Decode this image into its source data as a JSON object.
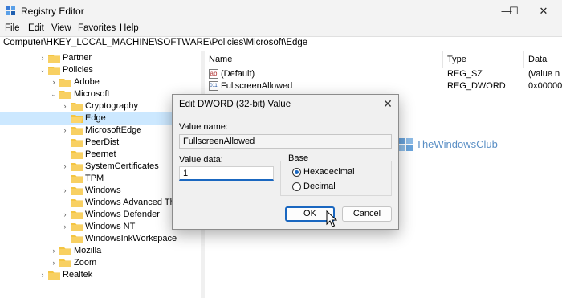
{
  "window": {
    "title": "Registry Editor",
    "controls": {
      "minimize": "—",
      "maximize": "☐",
      "close": "✕"
    }
  },
  "menu": [
    "File",
    "Edit",
    "View",
    "Favorites",
    "Help"
  ],
  "address": "Computer\\HKEY_LOCAL_MACHINE\\SOFTWARE\\Policies\\Microsoft\\Edge",
  "tree": [
    {
      "label": "Partner",
      "expander": "›"
    },
    {
      "label": "Policies",
      "expander": "⌄"
    },
    {
      "label": "Adobe",
      "expander": "›"
    },
    {
      "label": "Microsoft",
      "expander": "⌄"
    },
    {
      "label": "Cryptography",
      "expander": "›"
    },
    {
      "label": "Edge",
      "expander": "",
      "selected": true
    },
    {
      "label": "MicrosoftEdge",
      "expander": "›"
    },
    {
      "label": "PeerDist",
      "expander": ""
    },
    {
      "label": "Peernet",
      "expander": ""
    },
    {
      "label": "SystemCertificates",
      "expander": "›"
    },
    {
      "label": "TPM",
      "expander": ""
    },
    {
      "label": "Windows",
      "expander": "›"
    },
    {
      "label": "Windows Advanced Thre",
      "expander": ""
    },
    {
      "label": "Windows Defender",
      "expander": "›"
    },
    {
      "label": "Windows NT",
      "expander": "›"
    },
    {
      "label": "WindowsInkWorkspace",
      "expander": ""
    },
    {
      "label": "Mozilla",
      "expander": "›"
    },
    {
      "label": "Zoom",
      "expander": "›"
    },
    {
      "label": "Realtek",
      "expander": "›"
    }
  ],
  "list": {
    "columns": {
      "name": "Name",
      "type": "Type",
      "data": "Data"
    },
    "rows": [
      {
        "name": "(Default)",
        "type": "REG_SZ",
        "data": "(value n",
        "icon": "ab"
      },
      {
        "name": "FullscreenAllowed",
        "type": "REG_DWORD",
        "data": "0x00000",
        "icon": "011"
      }
    ]
  },
  "watermark": "TheWindowsClub",
  "dialog": {
    "title": "Edit DWORD (32-bit) Value",
    "close": "✕",
    "value_name_label": "Value name:",
    "value_name": "FullscreenAllowed",
    "value_data_label": "Value data:",
    "value_data": "1",
    "base_label": "Base",
    "hex_label": "Hexadecimal",
    "dec_label": "Decimal",
    "base_selected": "Hexadecimal",
    "ok": "OK",
    "cancel": "Cancel"
  },
  "colors": {
    "selection": "#cce8ff",
    "accent": "#1a67c0",
    "folder": "#f4c542"
  }
}
